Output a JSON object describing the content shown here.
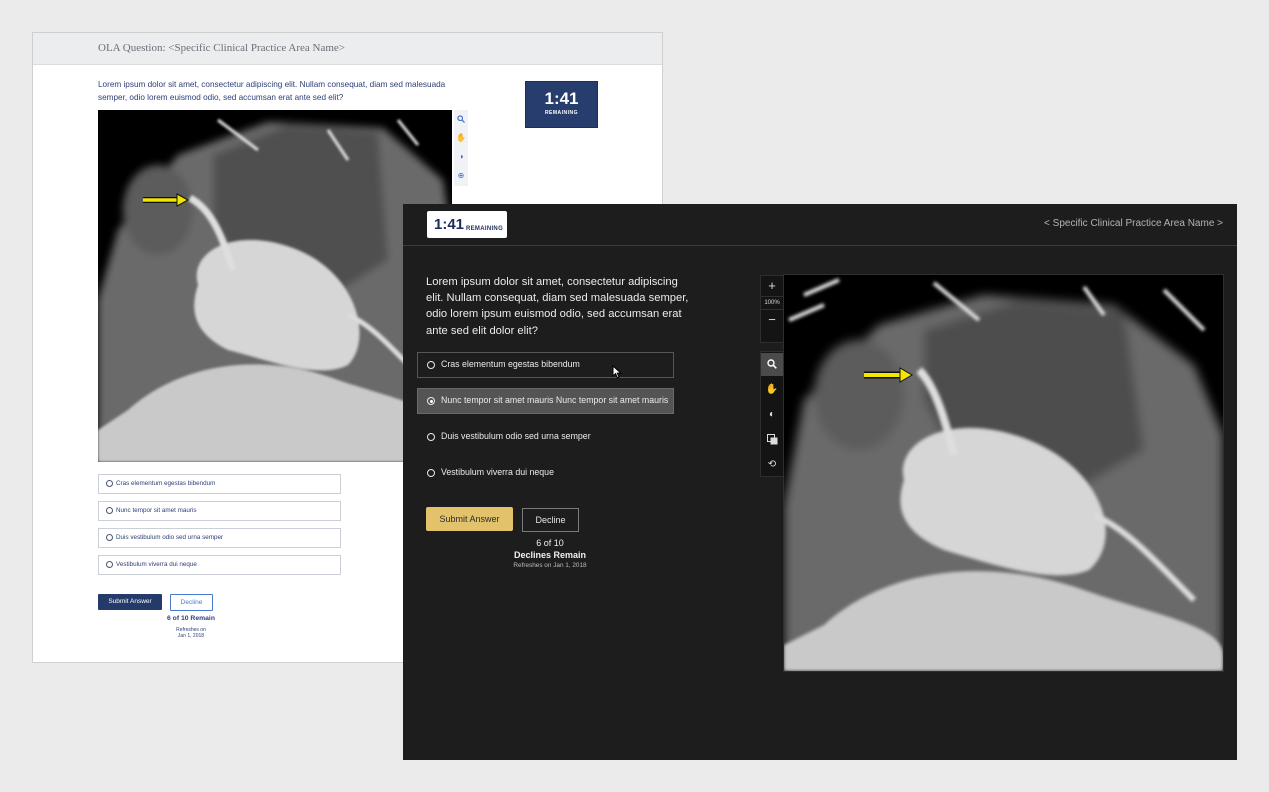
{
  "light_panel": {
    "header_title": "OLA Question: <Specific Clinical Practice Area Name>",
    "question": "Lorem ipsum dolor sit amet, consectetur adipiscing elit. Nullam consequat, diam sed malesuada semper, odio lorem euismod odio, sed accumsan erat ante sed elit?",
    "timer": {
      "time": "1:41",
      "label": "REMAINING"
    },
    "tools": [
      "search-icon",
      "hand-icon",
      "contrast-icon",
      "target-icon"
    ],
    "options": [
      "Cras elementum egestas bibendum",
      "Nunc tempor sit amet mauris",
      "Duis vestibulum odio sed urna semper",
      "Vestibulum viverra dui neque"
    ],
    "submit_label": "Submit Answer",
    "decline_label": "Decline",
    "remaining": "6 of 10 Remain",
    "refresh_line1": "Refreshes on",
    "refresh_line2": "Jan 1, 2018"
  },
  "dark_panel": {
    "timer": {
      "time": "1:41",
      "label": "REMAINING"
    },
    "area_name": "< Specific Clinical Practice Area Name >",
    "question": "Lorem ipsum dolor sit amet, consectetur adipiscing elit. Nullam consequat, diam sed malesuada semper, odio lorem ipsum euismod odio, sed accumsan erat ante sed elit dolor elit?",
    "options": [
      "Cras elementum egestas bibendum",
      "Nunc tempor sit amet mauris Nunc tempor sit amet mauris",
      "Duis vestibulum odio sed urna semper",
      "Vestibulum viverra dui neque"
    ],
    "selected_option_index": 1,
    "submit_label": "Submit Answer",
    "decline_label": "Decline",
    "count": "6 of 10",
    "declines_remain": "Declines Remain",
    "refresh": "Refreshes on Jan 1, 2018",
    "zoom": {
      "plus": "+",
      "level": "100%",
      "minus": "−"
    },
    "tools": [
      "search-icon",
      "hand-icon",
      "brightness-icon",
      "layers-icon",
      "reset-icon"
    ],
    "active_tool_index": 0
  },
  "colors": {
    "light_accent": "#273d6d",
    "dark_bg": "#1d1d1d",
    "submit_gold": "#e2c36b",
    "arrow_yellow": "#f2e600"
  }
}
